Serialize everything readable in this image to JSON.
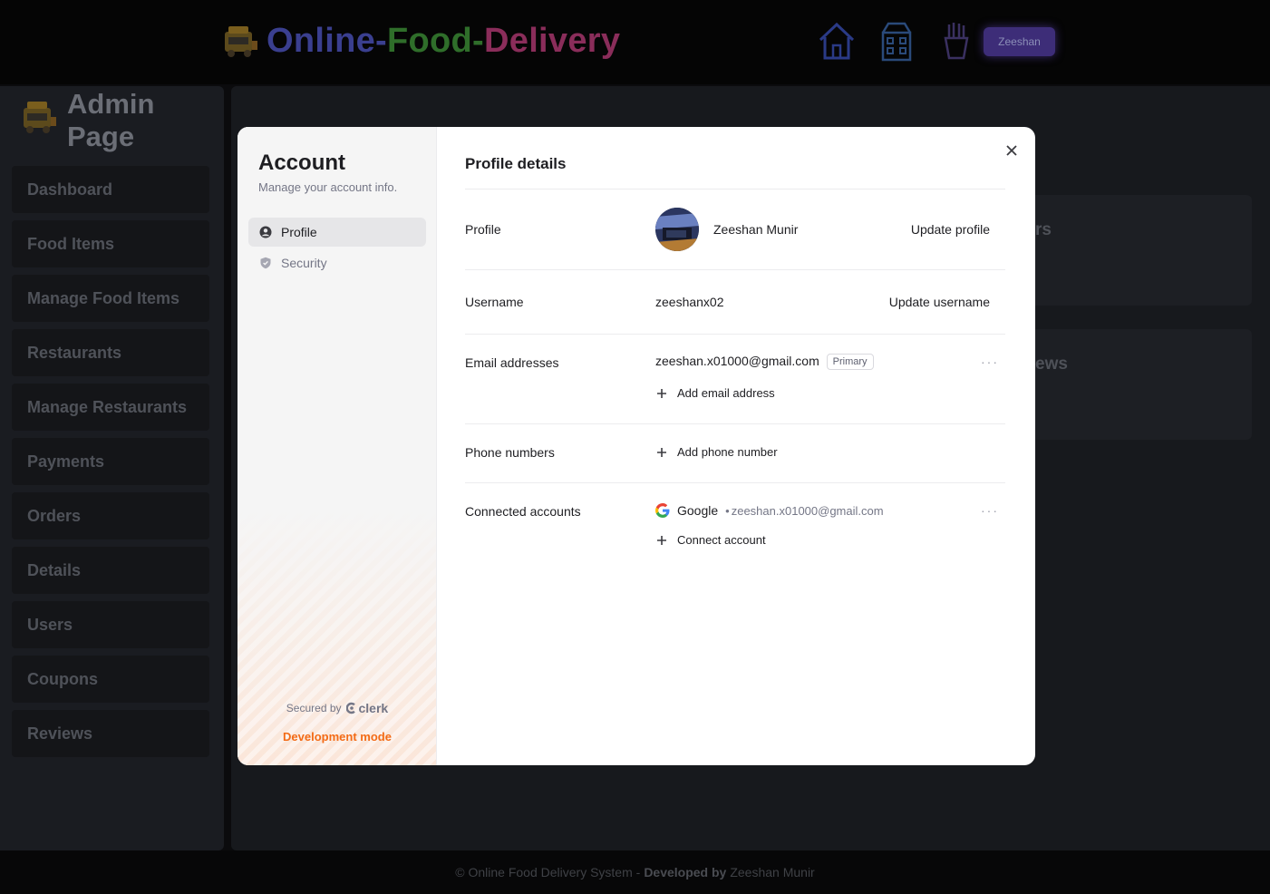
{
  "app": {
    "title_parts": [
      "Online-",
      "Food-",
      "Delivery"
    ],
    "user_button": "Zeeshan",
    "nav_icons": [
      "home-icon",
      "restaurant-building-icon",
      "fries-icon"
    ]
  },
  "sidebar": {
    "title_line1": "Admin",
    "title_line2": "Page",
    "items": [
      {
        "label": "Dashboard"
      },
      {
        "label": "Food Items"
      },
      {
        "label": "Manage Food Items"
      },
      {
        "label": "Restaurants"
      },
      {
        "label": "Manage Restaurants"
      },
      {
        "label": "Payments"
      },
      {
        "label": "Orders"
      },
      {
        "label": "Details"
      },
      {
        "label": "Users"
      },
      {
        "label": "Coupons"
      },
      {
        "label": "Reviews"
      }
    ]
  },
  "background_cards": [
    {
      "text": "rs"
    },
    {
      "text": "ews"
    }
  ],
  "footer": {
    "prefix": "© Online Food Delivery System -",
    "developed_by": "Developed by",
    "author": "Zeeshan Munir"
  },
  "modal": {
    "side": {
      "title": "Account",
      "subtitle": "Manage your account info.",
      "nav": [
        {
          "label": "Profile",
          "icon": "user-circle-icon",
          "active": true
        },
        {
          "label": "Security",
          "icon": "shield-icon",
          "active": false
        }
      ],
      "secured_by": "Secured by",
      "clerk": "clerk",
      "dev_mode": "Development mode"
    },
    "heading": "Profile details",
    "profile": {
      "label": "Profile",
      "name": "Zeeshan Munir",
      "action": "Update profile"
    },
    "username": {
      "label": "Username",
      "value": "zeeshanx02",
      "action": "Update username"
    },
    "email": {
      "label": "Email addresses",
      "value": "zeeshan.x01000@gmail.com",
      "badge": "Primary",
      "add": "Add email address"
    },
    "phone": {
      "label": "Phone numbers",
      "add": "Add phone number"
    },
    "connected": {
      "label": "Connected accounts",
      "provider": "Google",
      "separator": "•",
      "email": "zeeshan.x01000@gmail.com",
      "add": "Connect account"
    },
    "more_menu": "···",
    "colors": {
      "accent_orange": "#f36b16",
      "modal_bg": "#ffffff",
      "sidebar_bg": "#f6f6f6"
    }
  }
}
